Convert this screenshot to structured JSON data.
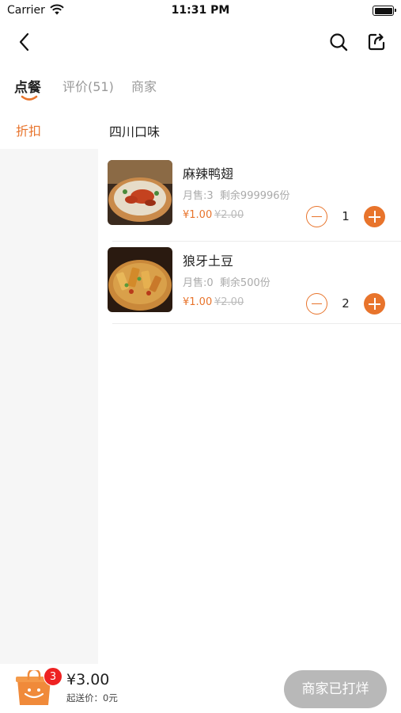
{
  "status_bar": {
    "carrier": "Carrier",
    "time": "11:31 PM"
  },
  "tabs": [
    {
      "label": "点餐",
      "active": true
    },
    {
      "label": "评价(51)",
      "active": false
    },
    {
      "label": "商家",
      "active": false
    }
  ],
  "sidebar": {
    "items": [
      {
        "label": "折扣",
        "selected": true
      }
    ]
  },
  "section": {
    "title": "四川口味"
  },
  "products": [
    {
      "name": "麻辣鸭翅",
      "monthly_sales": "月售:3",
      "stock": "剩余999996份",
      "price": "¥1.00",
      "original_price": "¥2.00",
      "quantity": "1"
    },
    {
      "name": "狼牙土豆",
      "monthly_sales": "月售:0",
      "stock": "剩余500份",
      "price": "¥1.00",
      "original_price": "¥2.00",
      "quantity": "2"
    }
  ],
  "cart": {
    "badge_count": "3",
    "total": "¥3.00",
    "min_delivery": "起送价：0元",
    "action_label": "商家已打烊"
  },
  "colors": {
    "accent": "#e8742c",
    "badge": "#e22222",
    "disabled_button": "#b8b8b8",
    "sidebar_bg": "#f6f6f6"
  },
  "icons": [
    "back-icon",
    "search-icon",
    "share-icon",
    "cart-icon",
    "minus-icon",
    "plus-icon"
  ]
}
